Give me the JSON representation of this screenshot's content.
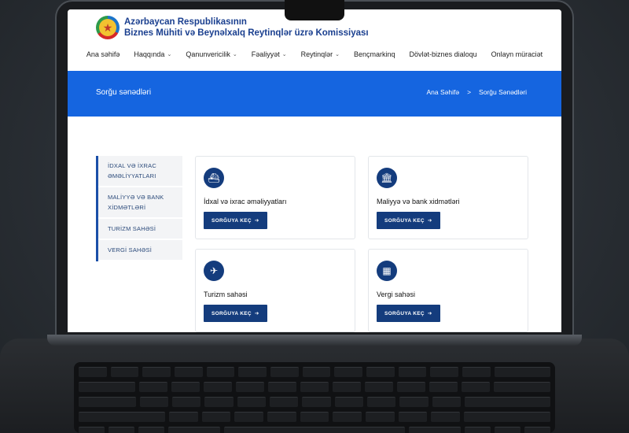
{
  "site": {
    "org_line1": "Azərbaycan Respublikasının",
    "org_line2": "Biznes Mühiti və Beynəlxalq Reytinqlər üzrə Komissiyası"
  },
  "nav": [
    {
      "label": "Ana səhifə",
      "dropdown": false
    },
    {
      "label": "Haqqında",
      "dropdown": true
    },
    {
      "label": "Qanunvericilik",
      "dropdown": true
    },
    {
      "label": "Fəaliyyət",
      "dropdown": true
    },
    {
      "label": "Reytinqlər",
      "dropdown": true
    },
    {
      "label": "Bençmarkinq",
      "dropdown": false
    },
    {
      "label": "Dövlət-biznes dialoqu",
      "dropdown": false
    },
    {
      "label": "Onlayn müraciət",
      "dropdown": false
    }
  ],
  "banner": {
    "title": "Sorğu sənədləri",
    "breadcrumb": [
      "Ana Səhifə",
      ">",
      "Sorğu Sənədləri"
    ]
  },
  "sidebar": [
    "İDXAL VƏ İXRAC ƏMƏLİYYATLARI",
    "MALİYYƏ VƏ BANK XİDMƏTLƏRİ",
    "TURİZM SAHƏSİ",
    "VERGİ SAHƏSİ"
  ],
  "cards": [
    {
      "title": "İdxal və ixrac əməliyyatları",
      "icon": "ship-icon",
      "glyph": "⛴",
      "button": "SORĞUYA KEÇ"
    },
    {
      "title": "Maliyyə və bank xidmətləri",
      "icon": "bank-icon",
      "glyph": "🏛",
      "button": "SORĞUYA KEÇ"
    },
    {
      "title": "Turizm sahəsi",
      "icon": "airplane-icon",
      "glyph": "✈",
      "button": "SORĞUYA KEÇ"
    },
    {
      "title": "Vergi sahəsi",
      "icon": "calculator-icon",
      "glyph": "▦",
      "button": "SORĞUYA KEÇ"
    }
  ],
  "colors": {
    "primary": "#1565e0",
    "dark_blue": "#143c7d"
  }
}
